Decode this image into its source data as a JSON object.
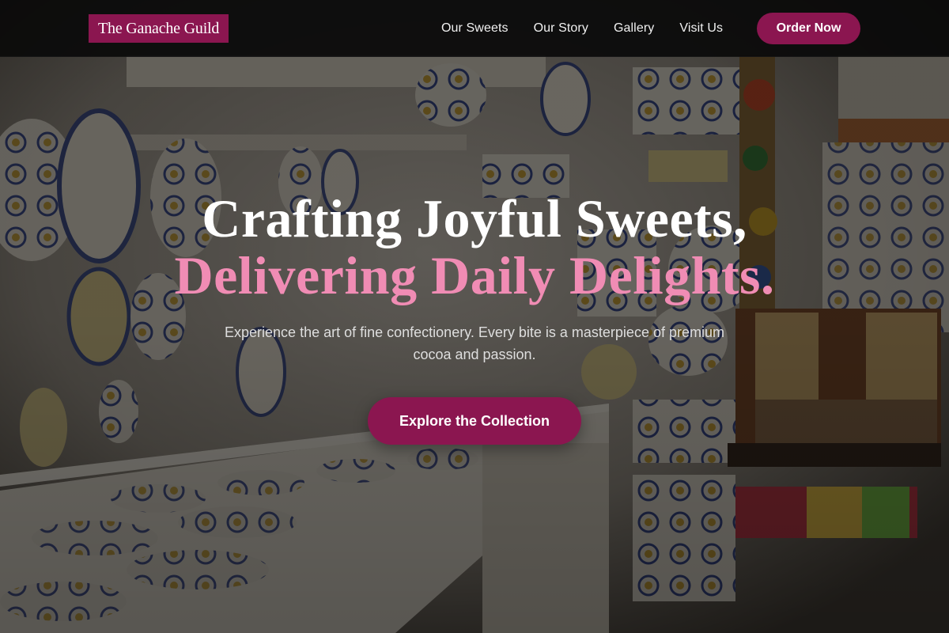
{
  "nav": {
    "logo": "The Ganache Guild",
    "links": [
      "Our Sweets",
      "Our Story",
      "Gallery",
      "Visit Us"
    ],
    "cta": "Order Now"
  },
  "hero": {
    "headline_line1": "Crafting Joyful Sweets,",
    "headline_line2": "Delivering Daily Delights.",
    "subtext": "Experience the art of fine confectionery. Every bite is a masterpiece of premium cocoa and passion.",
    "cta": "Explore the Collection"
  },
  "colors": {
    "brand": "#8b1650",
    "accent_pink": "#f08cb4",
    "nav_bg": "#0a0a0a"
  }
}
